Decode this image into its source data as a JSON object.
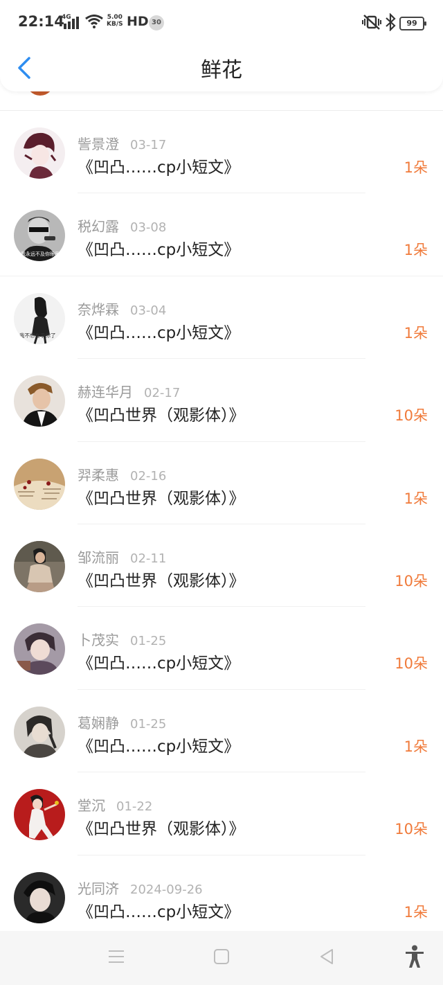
{
  "status": {
    "time": "22:14",
    "network": "4G",
    "speed_value": "5.00",
    "speed_unit": "KB/S",
    "hd": "HD",
    "notification_count": "30",
    "battery": "99"
  },
  "header": {
    "title": "鲜花"
  },
  "items": [
    {
      "name": "訾景澄",
      "date": "03-17",
      "title": "《凹凸……cp小短文》",
      "count": "1朵"
    },
    {
      "name": "税幻露",
      "date": "03-08",
      "title": "《凹凸……cp小短文》",
      "count": "1朵"
    },
    {
      "name": "奈烨霖",
      "date": "03-04",
      "title": "《凹凸……cp小短文》",
      "count": "1朵"
    },
    {
      "name": "赫连华月",
      "date": "02-17",
      "title": "《凹凸世界（观影体）》",
      "count": "10朵"
    },
    {
      "name": "羿柔惠",
      "date": "02-16",
      "title": "《凹凸世界（观影体）》",
      "count": "1朵"
    },
    {
      "name": "邹流丽",
      "date": "02-11",
      "title": "《凹凸世界（观影体）》",
      "count": "10朵"
    },
    {
      "name": "卜茂实",
      "date": "01-25",
      "title": "《凹凸……cp小短文》",
      "count": "10朵"
    },
    {
      "name": "葛娴静",
      "date": "01-25",
      "title": "《凹凸……cp小短文》",
      "count": "1朵"
    },
    {
      "name": "堂沉",
      "date": "01-22",
      "title": "《凹凸世界（观影体）》",
      "count": "10朵"
    },
    {
      "name": "光同济",
      "date": "2024-09-26",
      "title": "《凹凸……cp小短文》",
      "count": "1朵"
    }
  ],
  "avatar_images": {
    "0": {
      "text": ""
    },
    "1": {
      "text": "我永远不及你眼里"
    },
    "2": {
      "text": "我不想在乎你了"
    }
  },
  "colors": {
    "accent_blue": "#2e8df0",
    "count_orange": "#f07a3a"
  }
}
